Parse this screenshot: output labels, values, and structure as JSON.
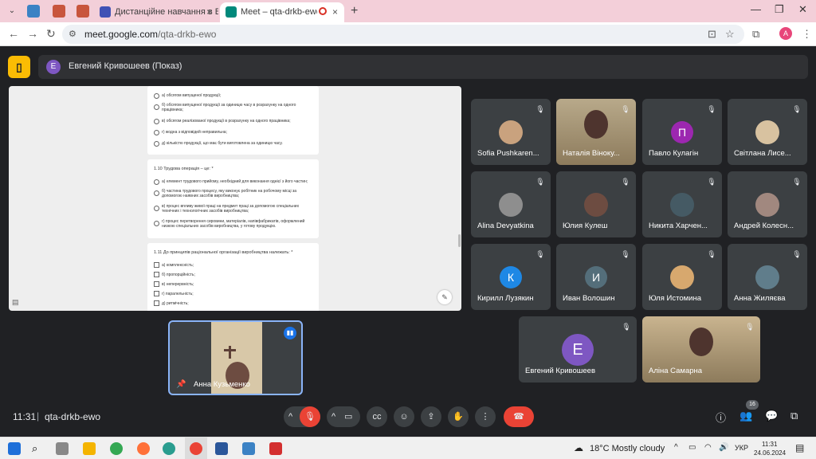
{
  "browser": {
    "tabs": [
      {
        "title": "Дистанційне навчання в ВСП",
        "active": false
      },
      {
        "title": "Meet – qta-drkb-ewo",
        "active": true
      }
    ],
    "url_host": "meet.google.com",
    "url_path": "/qta-drkb-ewo",
    "profile_initial": "A"
  },
  "meet": {
    "presenter": {
      "initial": "E",
      "label": "Евгений Кривошеев (Показ)"
    },
    "doc": {
      "q_prev_options": [
        "а) обсягом випущеної продукції;",
        "б) обсягом випущеної продукції за одиницю часу в розрахунку на одного працівника;",
        "в) обсягом реалізованої продукції в розрахунку на одного працівника;",
        "г) жодна з відповідей неправильна;",
        "д) кількістю продукції, що має бути виготовлена за одиницю часу."
      ],
      "q110_title": "1.10 Трудова операція – це: *",
      "q110_options": [
        "а) елемент трудового прийому, необхідний для виконання однієї з його частин;",
        "б) частина трудового процесу, яку виконує робітник на робочому місці за допомогою наявних засобів виробництва;",
        "в) процес впливу живої праці на предмет праці за допомогою спеціальних технічних і технологічних засобів виробництва;",
        "г) процес перетворення сировини, матеріалів, напівфабрикатів, оформлений низкою спеціальних засобів виробництва, у готову продукцію."
      ],
      "q111_title": "1.11 До принципів раціональної організації виробництва належать: *",
      "q111_options": [
        "а) комплексність;",
        "б) пропорційність;",
        "в) неперервність;",
        "г) паралельність;",
        "д) ритмічність;"
      ]
    },
    "participants": [
      {
        "name": "Sofia Pushkaren...",
        "type": "photo",
        "color": "#c9a27e"
      },
      {
        "name": "Наталія Віноку...",
        "type": "video",
        "color": "#b8a98a"
      },
      {
        "name": "Павло Кулагін",
        "type": "avatar",
        "initial": "П",
        "color": "#9c27b0"
      },
      {
        "name": "Світлана Лисе...",
        "type": "photo",
        "color": "#d8c2a0"
      },
      {
        "name": "Alina Devyatkina",
        "type": "photo",
        "color": "#8e8e8e"
      },
      {
        "name": "Юлия Кулеш",
        "type": "photo",
        "color": "#6d4c41"
      },
      {
        "name": "Никита Харчен...",
        "type": "photo",
        "color": "#455a64"
      },
      {
        "name": "Андрей Колесн...",
        "type": "photo",
        "color": "#a1887f"
      },
      {
        "name": "Кирилл Лузякин",
        "type": "avatar",
        "initial": "К",
        "color": "#1e88e5"
      },
      {
        "name": "Иван Волошин",
        "type": "avatar",
        "initial": "И",
        "color": "#546e7a"
      },
      {
        "name": "Юля Истомина",
        "type": "photo",
        "color": "#d7a86e"
      },
      {
        "name": "Анна Жиляєва",
        "type": "photo",
        "color": "#607d8b"
      },
      {
        "name": "Евгений Кривошеев",
        "type": "avatar",
        "initial": "E",
        "color": "#7e57c2"
      },
      {
        "name": "Аліна Самарна",
        "type": "video",
        "color": "#c9b48f"
      }
    ],
    "self": {
      "name": "Анна Кузьменко"
    },
    "time": "11:31",
    "separator": "|",
    "meeting_code": "qta-drkb-ewo",
    "participant_count": "16"
  },
  "taskbar": {
    "weather": "18°C  Mostly cloudy",
    "lang": "УКР",
    "time": "11:31",
    "date": "24.06.2024"
  },
  "colors": {
    "meet_bg": "#202124",
    "tile_bg": "#3c4043",
    "accent_blue": "#8ab4f8",
    "hangup_red": "#ea4335",
    "tab_bar": "#f3cfd9"
  },
  "icons": [
    "chevron-down-icon",
    "back-icon",
    "forward-icon",
    "reload-icon",
    "tune-icon",
    "camera-off-icon",
    "star-icon",
    "extensions-icon",
    "mic-off-icon",
    "pin-icon",
    "mic-icon",
    "videocam-icon",
    "captions-icon",
    "emoji-icon",
    "present-icon",
    "hand-icon",
    "more-icon",
    "call-end-icon",
    "info-icon",
    "people-icon",
    "chat-icon",
    "activities-icon"
  ]
}
